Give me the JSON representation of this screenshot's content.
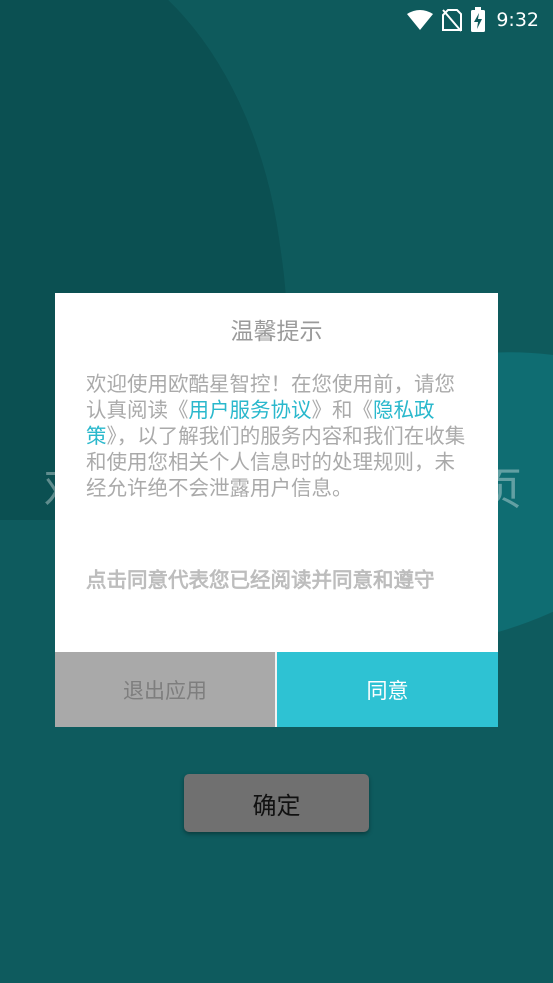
{
  "status_bar": {
    "time": "9:32",
    "icons": [
      "wifi-icon",
      "no-sim-icon",
      "battery-charging-icon"
    ]
  },
  "background": {
    "text_left": "欢",
    "text_right": "页"
  },
  "dialog": {
    "title": "温馨提示",
    "body": {
      "part1": "欢迎使用欧酷星智控！在您使用前，请您认真阅读《",
      "link_terms": "用户服务协议",
      "part2": "》和《",
      "link_privacy": "隐私政策",
      "part3": "》，以了解我们的服务内容和我们在收集和使用您相关个人信息时的处理规则，未经允许绝不会泄露用户信息。"
    },
    "note": "点击同意代表您已经阅读并同意和遵守",
    "exit_label": "退出应用",
    "agree_label": "同意"
  },
  "confirm_label": "确定",
  "colors": {
    "background": "#0e5a5c",
    "accent": "#2ec2d3",
    "link": "#2ab8cc",
    "exit_button": "#a9a9a9",
    "confirm_button": "#707070"
  }
}
